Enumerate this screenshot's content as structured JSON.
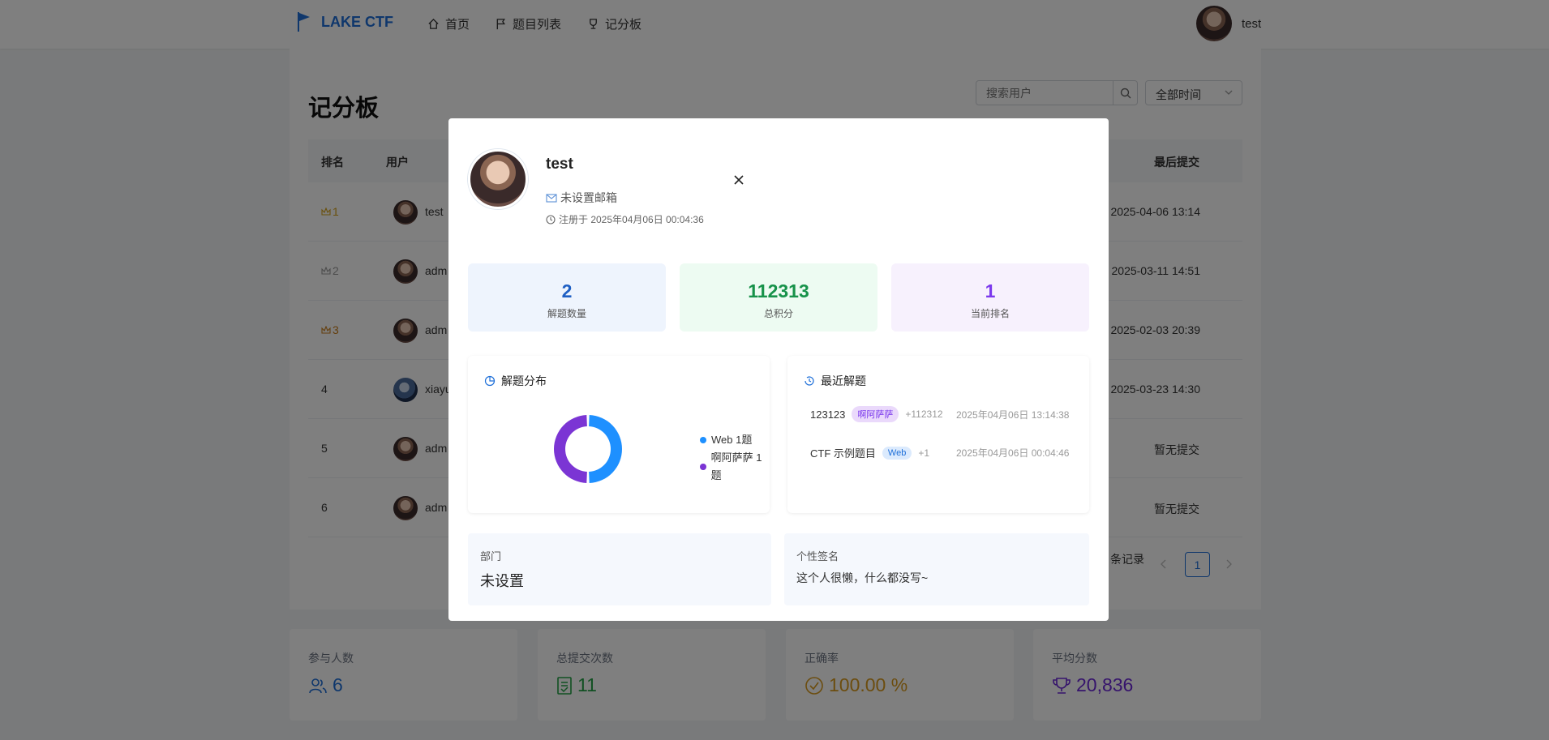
{
  "nav": {
    "logo_text": "LAKE CTF",
    "items": [
      {
        "label": "首页",
        "icon": "home-icon"
      },
      {
        "label": "题目列表",
        "icon": "flag-icon"
      },
      {
        "label": "记分板",
        "icon": "trophy-icon"
      }
    ],
    "user": "test"
  },
  "page": {
    "title": "记分板",
    "search_placeholder": "搜索用户",
    "time_filter": "全部时间",
    "columns": {
      "rank": "排名",
      "user": "用户",
      "last_submit": "最后提交"
    },
    "rows": [
      {
        "rank": "1",
        "user": "test",
        "last": "2025-04-06 13:14"
      },
      {
        "rank": "2",
        "user": "adm",
        "last": "2025-03-11 14:51"
      },
      {
        "rank": "3",
        "user": "adm",
        "last": "2025-02-03 20:39"
      },
      {
        "rank": "4",
        "user": "xiayu",
        "last": "2025-03-23 14:30"
      },
      {
        "rank": "5",
        "user": "adm",
        "last": "暂无提交"
      },
      {
        "rank": "6",
        "user": "adm",
        "last": "暂无提交"
      }
    ],
    "pagination": {
      "records": "条记录",
      "page": "1"
    }
  },
  "stats": [
    {
      "label": "参与人数",
      "value": "6",
      "icon": "users-icon",
      "color": "#1e6fd9"
    },
    {
      "label": "总提交次数",
      "value": "11",
      "icon": "document-icon",
      "color": "#22a045"
    },
    {
      "label": "正确率",
      "value": "100.00 %",
      "icon": "check-circle-icon",
      "color": "#d99a1e"
    },
    {
      "label": "平均分数",
      "value": "20,836",
      "icon": "trophy-icon",
      "color": "#6d28d9"
    }
  ],
  "modal": {
    "name": "test",
    "email": "未设置邮箱",
    "registered": "注册于 2025年04月06日 00:04:36",
    "boxes": [
      {
        "value": "2",
        "label": "解题数量"
      },
      {
        "value": "112313",
        "label": "总积分"
      },
      {
        "value": "1",
        "label": "当前排名"
      }
    ],
    "dist_title": "解题分布",
    "recent_title": "最近解题",
    "recent": [
      {
        "name": "123123",
        "tag": "啊阿萨萨",
        "points": "+112312",
        "date": "2025年04月06日 13:14:38"
      },
      {
        "name": "CTF 示例题目",
        "tag": "Web",
        "points": "+1",
        "date": "2025年04月06日 00:04:46"
      }
    ],
    "dept_label": "部门",
    "dept_value": "未设置",
    "sig_label": "个性签名",
    "sig_value": "这个人很懒，什么都没写~"
  },
  "chart_data": {
    "type": "pie",
    "categories": [
      "Web",
      "啊阿萨萨"
    ],
    "values": [
      1,
      1
    ],
    "legend": [
      "Web 1题",
      "啊阿萨萨 1题"
    ],
    "colors": [
      "#1e90ff",
      "#7b35d4"
    ],
    "donut": true
  }
}
